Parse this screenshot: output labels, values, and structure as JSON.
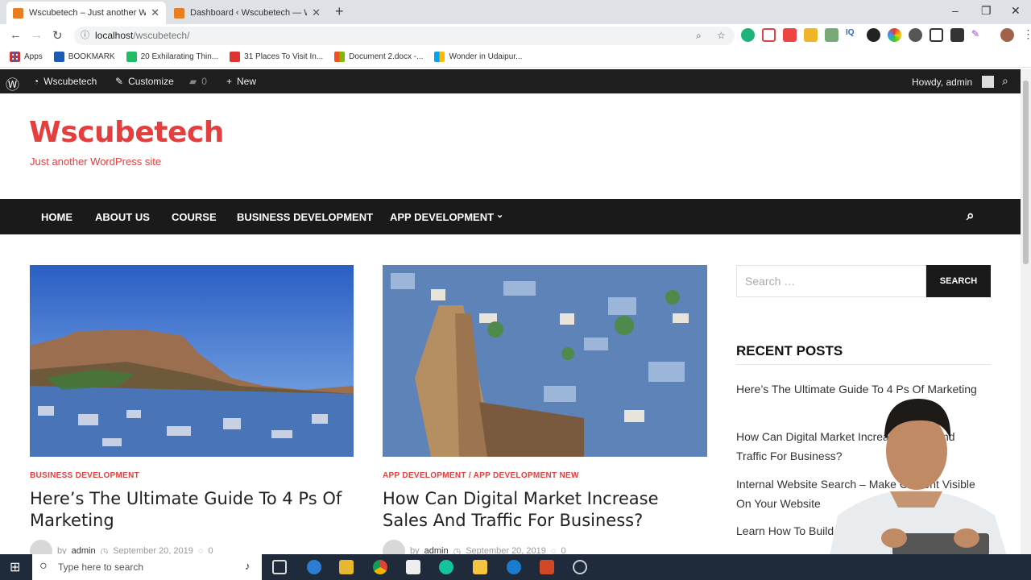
{
  "browser": {
    "tabs": [
      {
        "title": "Wscubetech – Just another Wor",
        "active": true
      },
      {
        "title": "Dashboard ‹ Wscubetech — Wor",
        "active": false
      }
    ],
    "url_host": "localhost",
    "url_path": "/wscubetech/",
    "bookmarks": [
      "Apps",
      "BOOKMARK",
      "20 Exhilarating Thin...",
      "31 Places To Visit In...",
      "Document 2.docx -...",
      "Wonder in Udaipur..."
    ]
  },
  "adminbar": {
    "site": "Wscubetech",
    "customize": "Customize",
    "comments": "0",
    "new": "New",
    "howdy": "Howdy, admin"
  },
  "site": {
    "title": "Wscubetech",
    "tagline": "Just another WordPress site",
    "accent": "#e53e3e"
  },
  "nav": {
    "items": [
      "HOME",
      "ABOUT US",
      "COURSE",
      "BUSINESS DEVELOPMENT",
      "APP DEVELOPMENT"
    ]
  },
  "posts": [
    {
      "category": "BUSINESS DEVELOPMENT",
      "title": "Here’s The Ultimate Guide To 4 Ps Of Marketing",
      "by": "by",
      "author": "admin",
      "date": "September 20, 2019",
      "comments": "0"
    },
    {
      "category": "APP DEVELOPMENT / APP DEVELOPMENT NEW",
      "title": "How Can Digital Market Increase Sales And Traffic For Business?",
      "by": "by",
      "author": "admin",
      "date": "September 20, 2019",
      "comments": "0"
    }
  ],
  "sidebar": {
    "search_placeholder": "Search …",
    "search_button": "SEARCH",
    "recent_heading": "RECENT POSTS",
    "recent": [
      "Here’s The Ultimate Guide To 4 Ps Of Marketing",
      "How Can Digital Market Increase Sales And Traffic For Business?",
      "Internal Website Search – Make Content Visible On Your Website",
      "Learn How To Build Social Media"
    ]
  },
  "taskbar": {
    "search_placeholder": "Type here to search"
  }
}
